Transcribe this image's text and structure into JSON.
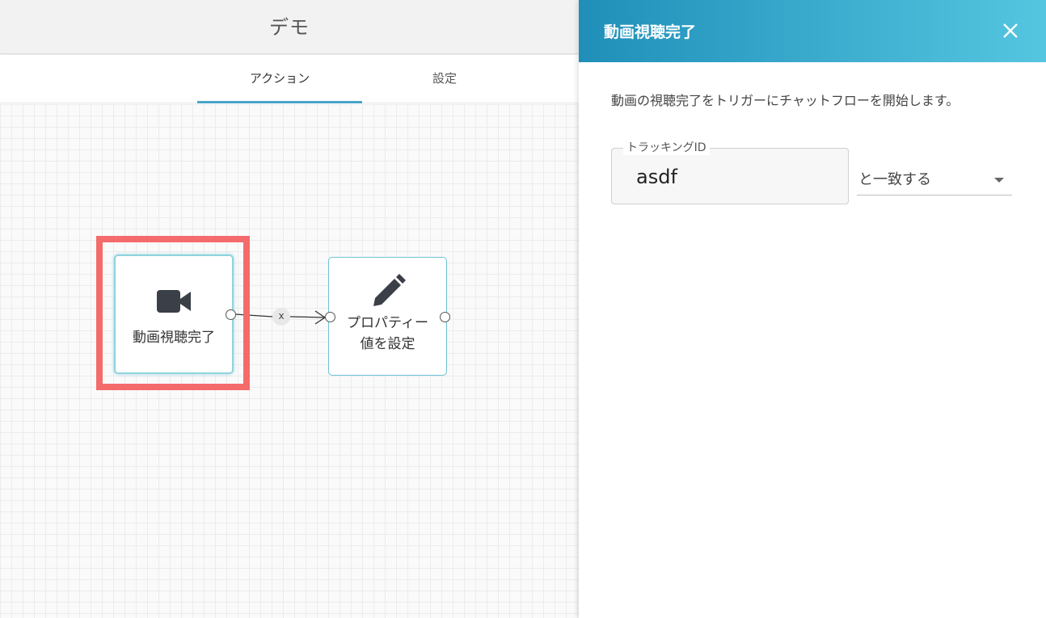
{
  "header": {
    "title": "デモ"
  },
  "tabs": [
    {
      "label": "アクション",
      "active": true
    },
    {
      "label": "設定",
      "active": false
    }
  ],
  "canvas": {
    "nodes": [
      {
        "label": "動画視聴完了",
        "icon": "video-camera-icon",
        "selected": true
      },
      {
        "label_line1": "プロパティー",
        "label_line2": "値を設定",
        "icon": "pencil-icon"
      }
    ],
    "edge_delete_label": "x"
  },
  "panel": {
    "title": "動画視聴完了",
    "description": "動画の視聴完了をトリガーにチャットフローを開始します。",
    "tracking_field": {
      "label": "トラッキングID",
      "value": "asdf"
    },
    "match_select": {
      "value": "と一致する"
    }
  },
  "colors": {
    "accent": "#4aa3c7",
    "panel_header_start": "#1f8fb9",
    "panel_header_end": "#55c6e0",
    "highlight": "#f46b6b",
    "node_border": "#6fc3d5"
  }
}
